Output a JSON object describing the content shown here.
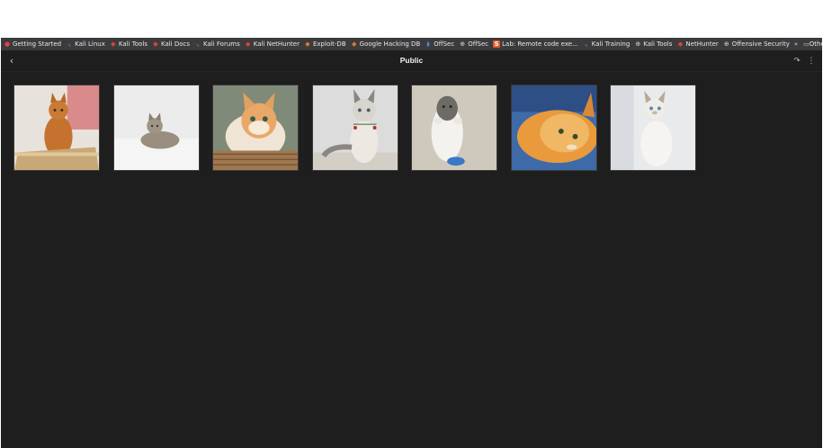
{
  "bookmarks": [
    {
      "label": "Getting Started",
      "icon": "firefox-icon"
    },
    {
      "label": "Kali Linux",
      "icon": "kali-dragon-icon"
    },
    {
      "label": "Kali Tools",
      "icon": "kali-tools-icon"
    },
    {
      "label": "Kali Docs",
      "icon": "kali-docs-icon"
    },
    {
      "label": "Kali Forums",
      "icon": "kali-dragon-icon"
    },
    {
      "label": "Kali NetHunter",
      "icon": "nethunter-icon"
    },
    {
      "label": "Exploit-DB",
      "icon": "exploit-db-icon"
    },
    {
      "label": "Google Hacking DB",
      "icon": "exploit-db-icon"
    },
    {
      "label": "OffSec",
      "icon": "offsec-icon"
    },
    {
      "label": "OffSec",
      "icon": "globe-icon"
    },
    {
      "label": "Lab: Remote code exe...",
      "icon": "portswigger-icon"
    },
    {
      "label": "Kali Training",
      "icon": "kali-dragon-icon"
    },
    {
      "label": "Kali Tools",
      "icon": "globe-icon"
    },
    {
      "label": "NetHunter",
      "icon": "nethunter-icon"
    },
    {
      "label": "Offensive Security",
      "icon": "globe-icon"
    }
  ],
  "more_bookmarks": "»",
  "other_bookmarks": "Other Bookmarks",
  "header": {
    "title": "Public",
    "back_glyph": "‹",
    "share_glyph": "↷",
    "info_glyph": "⋮"
  },
  "photos": [
    {
      "subject": "orange cat sitting in cardboard box"
    },
    {
      "subject": "tabby kitten lying on white blanket"
    },
    {
      "subject": "ginger and white cat in wicker basket"
    },
    {
      "subject": "fluffy grey kitten with red berries collar"
    },
    {
      "subject": "grey and white kitten lying on its back with toy"
    },
    {
      "subject": "fluffy orange cat lying on blue background"
    },
    {
      "subject": "white siamese kitten looking up"
    }
  ]
}
